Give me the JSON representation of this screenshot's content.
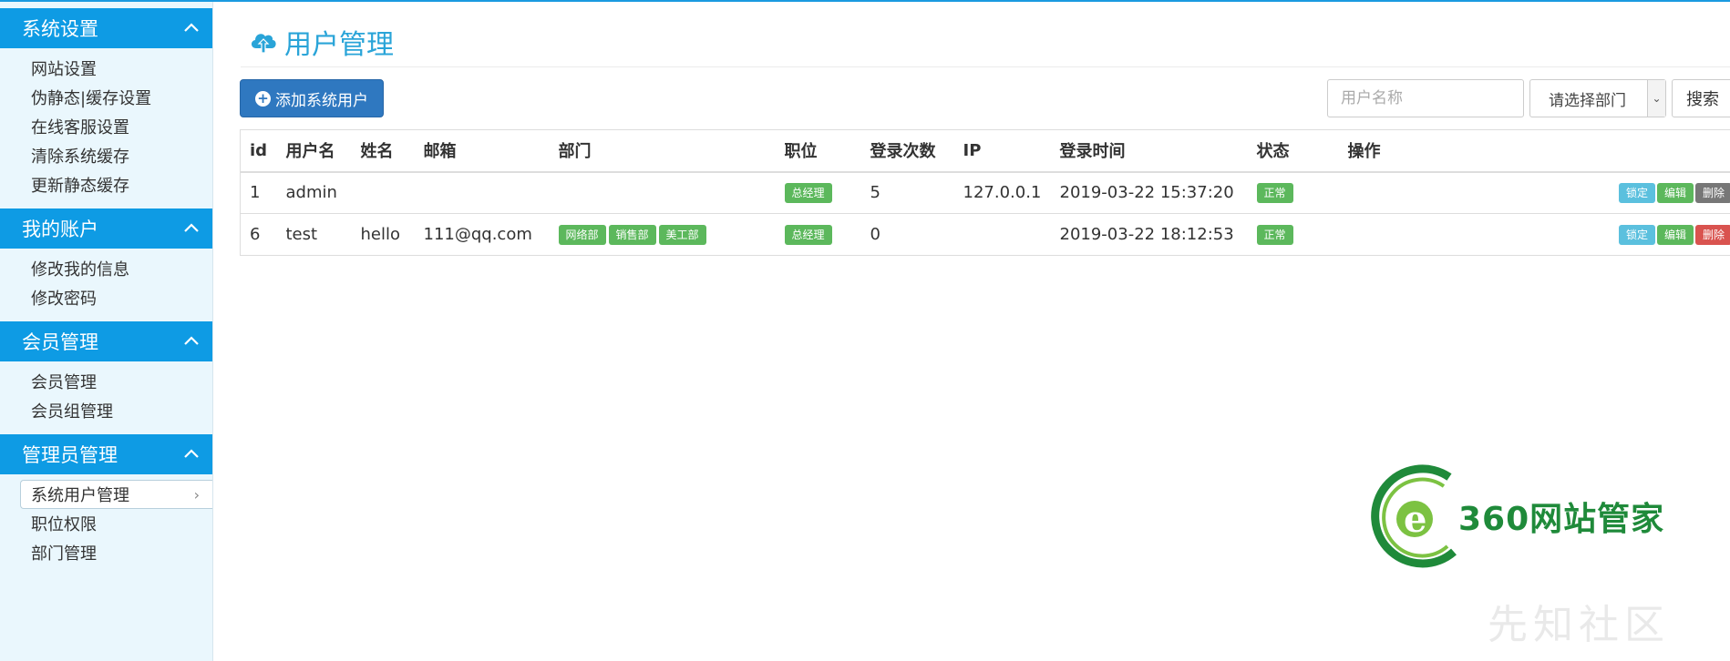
{
  "sidebar": {
    "sections": [
      {
        "title": "系统设置",
        "items": [
          "网站设置",
          "伪静态|缓存设置",
          "在线客服设置",
          "清除系统缓存",
          "更新静态缓存"
        ]
      },
      {
        "title": "我的账户",
        "items": [
          "修改我的信息",
          "修改密码"
        ]
      },
      {
        "title": "会员管理",
        "items": [
          "会员管理",
          "会员组管理"
        ]
      },
      {
        "title": "管理员管理",
        "items": [
          "系统用户管理",
          "职位权限",
          "部门管理"
        ]
      }
    ],
    "active_item": "系统用户管理"
  },
  "page": {
    "title": "用户管理"
  },
  "toolbar": {
    "add_label": "添加系统用户",
    "search_placeholder": "用户名称",
    "dept_select_value": "请选择部门",
    "search_label": "搜索"
  },
  "table": {
    "headers": [
      "id",
      "用户名",
      "姓名",
      "邮箱",
      "部门",
      "职位",
      "登录次数",
      "IP",
      "登录时间",
      "状态",
      "操作"
    ],
    "rows": [
      {
        "id": "1",
        "username": "admin",
        "name": "",
        "email": "",
        "departments": [],
        "position": "总经理",
        "logins": "5",
        "ip": "127.0.0.1",
        "login_time": "2019-03-22 15:37:20",
        "status": "正常"
      },
      {
        "id": "6",
        "username": "test",
        "name": "hello",
        "email": "111@qq.com",
        "departments": [
          "网络部",
          "销售部",
          "美工部"
        ],
        "position": "总经理",
        "logins": "0",
        "ip": "",
        "login_time": "2019-03-22 18:12:53",
        "status": "正常"
      }
    ],
    "actions": {
      "lock": "锁定",
      "edit": "编辑",
      "delete": "删除"
    }
  },
  "watermark": {
    "logo_text": "360网站管家",
    "faint_text": "先知社区"
  },
  "colors": {
    "primary": "#0e9be4",
    "title": "#29a4d8",
    "button": "#2f78c0",
    "success": "#5cb85c",
    "info": "#5bc0de",
    "danger": "#d9534f",
    "muted": "#777777"
  }
}
